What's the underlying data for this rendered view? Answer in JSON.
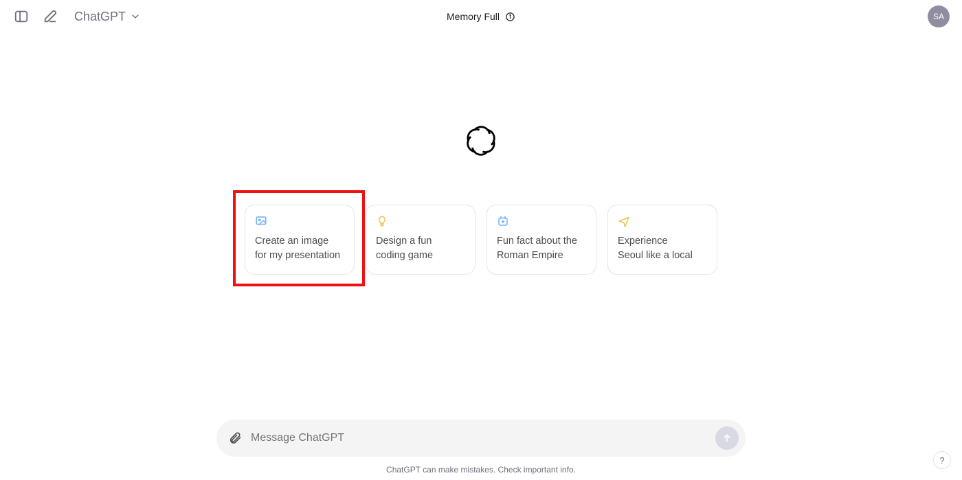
{
  "header": {
    "model_label": "ChatGPT",
    "memory_status": "Memory Full",
    "avatar_initials": "SA"
  },
  "suggestions": [
    {
      "icon": "image-icon",
      "color": "#6db1ff",
      "line1": "Create an image",
      "line2": "for my presentation"
    },
    {
      "icon": "lightbulb-icon",
      "color": "#e8c34a",
      "line1": "Design a fun",
      "line2": "coding game"
    },
    {
      "icon": "sparkle-icon",
      "color": "#6db1ff",
      "line1": "Fun fact about the",
      "line2": "Roman Empire"
    },
    {
      "icon": "plane-icon",
      "color": "#e8c34a",
      "line1": "Experience",
      "line2": "Seoul like a local"
    }
  ],
  "highlight_index": 0,
  "input": {
    "placeholder": "Message ChatGPT"
  },
  "footer": {
    "disclaimer": "ChatGPT can make mistakes. Check important info."
  },
  "help_label": "?"
}
